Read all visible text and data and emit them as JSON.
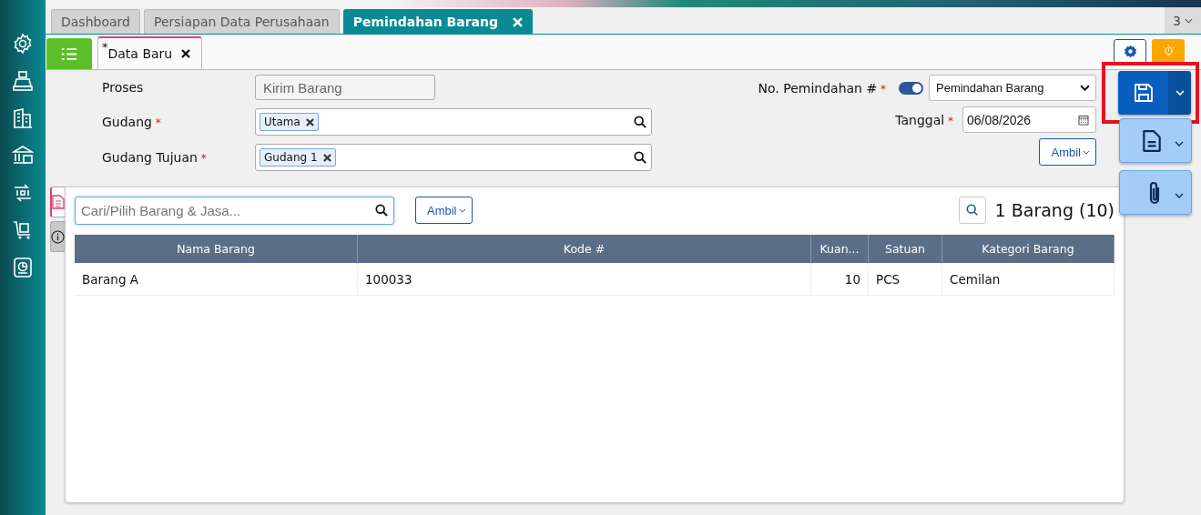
{
  "app_tabs": [
    {
      "label": "Dashboard",
      "selected": false,
      "closable": false
    },
    {
      "label": "Persiapan Data Perusahaan",
      "selected": false,
      "closable": false
    },
    {
      "label": "Pemindahan Barang",
      "selected": true,
      "closable": true
    }
  ],
  "tab_count": "3",
  "sub_tabs": [
    {
      "label": "Data Baru",
      "modified_mark": "*",
      "selected": true
    }
  ],
  "form": {
    "proses": {
      "label": "Proses",
      "value": "Kirim Barang"
    },
    "gudang": {
      "label": "Gudang",
      "required": true,
      "tags": [
        "Utama"
      ]
    },
    "gudang_tujuan": {
      "label": "Gudang Tujuan",
      "required": true,
      "tags": [
        "Gudang 1"
      ]
    },
    "no_pemindahan": {
      "label": "No. Pemindahan #",
      "required": true,
      "toggle_on": true,
      "value": "Pemindahan Barang"
    },
    "tanggal": {
      "label": "Tanggal",
      "required": true,
      "value": "06/08/2026"
    },
    "ambil_button": "Ambil"
  },
  "panel": {
    "side_tabs": [
      {
        "kind": "document",
        "selected": true
      },
      {
        "kind": "info",
        "selected": false
      }
    ],
    "search": {
      "placeholder": "Cari/Pilih Barang & Jasa..."
    },
    "ambil_button": "Ambil",
    "summary": "1 Barang (10)",
    "table": {
      "columns": [
        "Nama Barang",
        "Kode #",
        "Kuan...",
        "Satuan",
        "Kategori Barang"
      ],
      "rows": [
        [
          "Barang A",
          "100033",
          "10",
          "PCS",
          "Cemilan"
        ]
      ]
    }
  },
  "save_highlighted": true
}
